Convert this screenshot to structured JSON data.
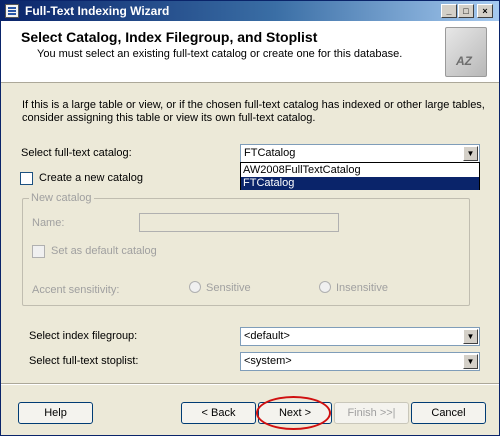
{
  "window": {
    "title": "Full-Text Indexing Wizard",
    "min_label": "_",
    "max_label": "□",
    "close_label": "×"
  },
  "header": {
    "title": "Select Catalog, Index Filegroup, and Stoplist",
    "subtitle": "You must select an existing full-text catalog or create one for this database.",
    "icon_text": "AZ"
  },
  "intro_text": "If this is a large table or view, or if the chosen full-text catalog has indexed or other large tables, consider assigning this table or view its own full-text catalog.",
  "catalog": {
    "label": "Select full-text catalog:",
    "value": "FTCatalog",
    "options": [
      "AW2008FullTextCatalog",
      "FTCatalog"
    ],
    "selected_option": "FTCatalog"
  },
  "create_new": {
    "label": "Create a new catalog",
    "checked": false
  },
  "new_catalog": {
    "group_title": "New catalog",
    "name_label": "Name:",
    "name_value": "",
    "default_label": "Set as default catalog",
    "accent_label": "Accent sensitivity:",
    "sensitive_label": "Sensitive",
    "insensitive_label": "Insensitive"
  },
  "filegroup": {
    "label": "Select index filegroup:",
    "value": "<default>"
  },
  "stoplist": {
    "label": "Select full-text stoplist:",
    "value": "<system>"
  },
  "buttons": {
    "help": "Help",
    "back": "< Back",
    "next": "Next >",
    "finish": "Finish >>|",
    "cancel": "Cancel"
  },
  "colors": {
    "title_bar": "#0a246a",
    "selection": "#0a246a",
    "highlight_ring": "#d01010",
    "dialog_bg": "#ece9d8"
  }
}
